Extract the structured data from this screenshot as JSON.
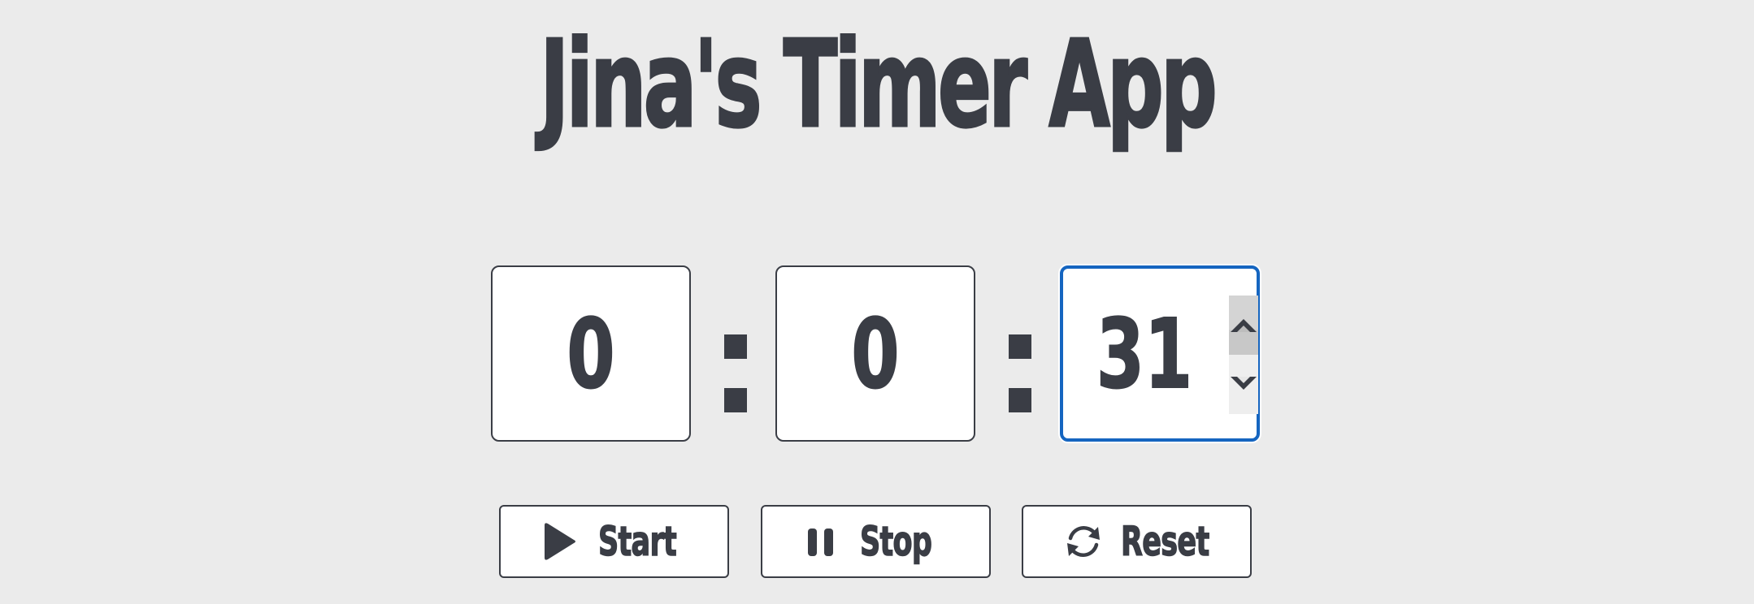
{
  "app": {
    "title": "Jina's Timer App"
  },
  "timer": {
    "hours": "0",
    "minutes": "0",
    "seconds": "31",
    "separator": ":"
  },
  "buttons": {
    "start": {
      "label": "Start",
      "icon": "play-icon"
    },
    "stop": {
      "label": "Stop",
      "icon": "pause-icon"
    },
    "reset": {
      "label": "Reset",
      "icon": "refresh-icon"
    }
  },
  "colors": {
    "background": "#ebebeb",
    "text": "#3a3d45",
    "focus_border": "#1565c0",
    "box_background": "#ffffff"
  }
}
